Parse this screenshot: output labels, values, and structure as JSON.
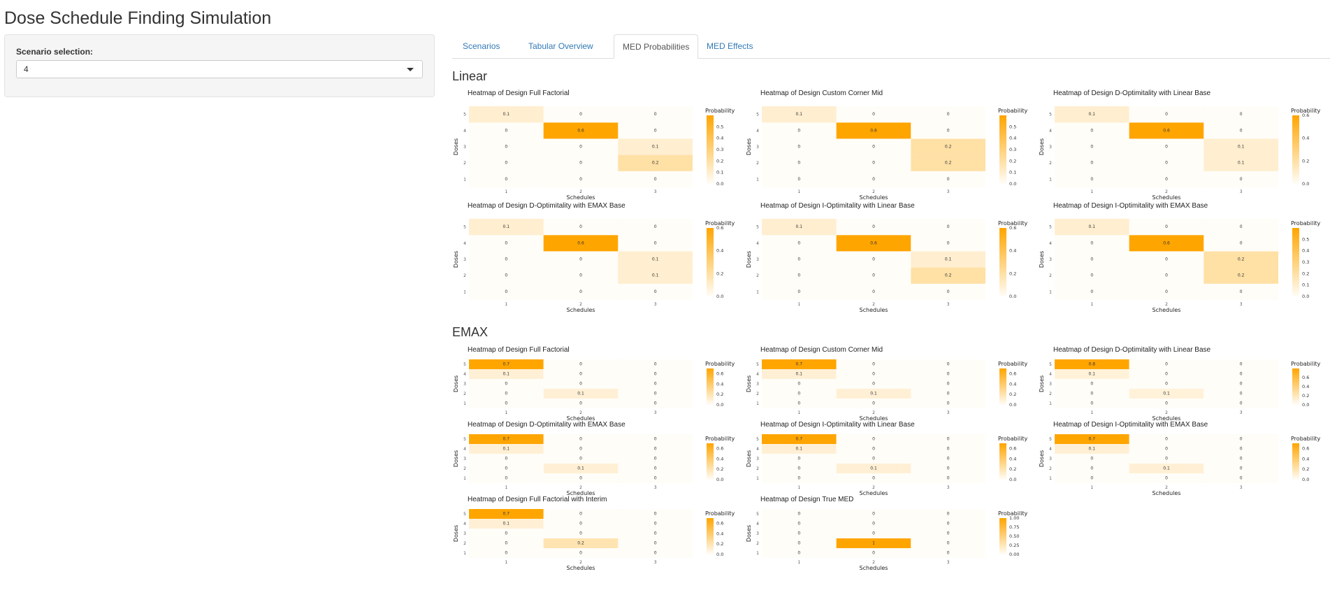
{
  "app": {
    "title": "Dose Schedule Finding Simulation"
  },
  "sidebar": {
    "scenario_label": "Scenario selection:",
    "scenario_value": "4"
  },
  "tabs": [
    {
      "label": "Scenarios",
      "active": false
    },
    {
      "label": "Tabular Overview",
      "active": false
    },
    {
      "label": "MED Probabilities",
      "active": true
    },
    {
      "label": "MED Effects",
      "active": false
    }
  ],
  "colors": {
    "low": "#fffdf8",
    "high": "#ffa500",
    "grid": "#eeeeee"
  },
  "axis": {
    "x_label": "Schedules",
    "y_label": "Doses",
    "x_ticks": [
      "1",
      "2",
      "3"
    ],
    "y_ticks": [
      "1",
      "2",
      "3",
      "4",
      "5"
    ],
    "legend_title": "Probability"
  },
  "sections": [
    {
      "name": "Linear",
      "chart_data": [
        {
          "type": "heatmap",
          "title": "Heatmap of Design Full Factorial",
          "values": [
            [
              0,
              0,
              0
            ],
            [
              0,
              0,
              0.2
            ],
            [
              0,
              0,
              0.1
            ],
            [
              0,
              0.6,
              0
            ],
            [
              0.1,
              0,
              0
            ]
          ],
          "legend_ticks": [
            "0.0",
            "0.1",
            "0.2",
            "0.3",
            "0.4",
            "0.5"
          ],
          "legend_max": 0.6
        },
        {
          "type": "heatmap",
          "title": "Heatmap of Design Custom Corner Mid",
          "values": [
            [
              0,
              0,
              0
            ],
            [
              0,
              0,
              0.2
            ],
            [
              0,
              0,
              0.2
            ],
            [
              0,
              0.6,
              0
            ],
            [
              0.1,
              0,
              0
            ]
          ],
          "legend_ticks": [
            "0.0",
            "0.1",
            "0.2",
            "0.3",
            "0.4",
            "0.5"
          ],
          "legend_max": 0.6
        },
        {
          "type": "heatmap",
          "title": "Heatmap of Design D-Optimitality with Linear Base",
          "values": [
            [
              0,
              0,
              0
            ],
            [
              0,
              0,
              0.1
            ],
            [
              0,
              0,
              0.1
            ],
            [
              0,
              0.6,
              0
            ],
            [
              0.1,
              0,
              0
            ]
          ],
          "legend_ticks": [
            "0.0",
            "0.2",
            "0.4",
            "0.6"
          ],
          "legend_max": 0.6
        },
        {
          "type": "heatmap",
          "title": "Heatmap of Design D-Optimitality with EMAX Base",
          "values": [
            [
              0,
              0,
              0
            ],
            [
              0,
              0,
              0.1
            ],
            [
              0,
              0,
              0.1
            ],
            [
              0,
              0.6,
              0
            ],
            [
              0.1,
              0,
              0
            ]
          ],
          "legend_ticks": [
            "0.0",
            "0.2",
            "0.4",
            "0.6"
          ],
          "legend_max": 0.6
        },
        {
          "type": "heatmap",
          "title": "Heatmap of Design I-Optimitality with Linear Base",
          "values": [
            [
              0,
              0,
              0
            ],
            [
              0,
              0,
              0.2
            ],
            [
              0,
              0,
              0.1
            ],
            [
              0,
              0.6,
              0
            ],
            [
              0.1,
              0,
              0
            ]
          ],
          "legend_ticks": [
            "0.0",
            "0.2",
            "0.4",
            "0.6"
          ],
          "legend_max": 0.6
        },
        {
          "type": "heatmap",
          "title": "Heatmap of Design I-Optimitality with EMAX Base",
          "values": [
            [
              0,
              0,
              0
            ],
            [
              0,
              0,
              0.2
            ],
            [
              0,
              0,
              0.2
            ],
            [
              0,
              0.6,
              0
            ],
            [
              0.1,
              0,
              0
            ]
          ],
          "legend_ticks": [
            "0.0",
            "0.1",
            "0.2",
            "0.3",
            "0.4",
            "0.5"
          ],
          "legend_max": 0.6
        }
      ]
    },
    {
      "name": "EMAX",
      "chart_data": [
        {
          "type": "heatmap",
          "title": "Heatmap of Design Full Factorial",
          "values": [
            [
              0,
              0,
              0
            ],
            [
              0,
              0.1,
              0
            ],
            [
              0,
              0,
              0
            ],
            [
              0.1,
              0,
              0
            ],
            [
              0.7,
              0,
              0
            ]
          ],
          "legend_ticks": [
            "0.0",
            "0.2",
            "0.4",
            "0.6"
          ],
          "legend_max": 0.7
        },
        {
          "type": "heatmap",
          "title": "Heatmap of Design Custom Corner Mid",
          "values": [
            [
              0,
              0,
              0
            ],
            [
              0,
              0.1,
              0
            ],
            [
              0,
              0,
              0
            ],
            [
              0.1,
              0,
              0
            ],
            [
              0.7,
              0,
              0
            ]
          ],
          "legend_ticks": [
            "0.0",
            "0.2",
            "0.4",
            "0.6"
          ],
          "legend_max": 0.7
        },
        {
          "type": "heatmap",
          "title": "Heatmap of Design D-Optimitality with Linear Base",
          "values": [
            [
              0,
              0,
              0
            ],
            [
              0,
              0.1,
              0
            ],
            [
              0,
              0,
              0
            ],
            [
              0.1,
              0,
              0
            ],
            [
              0.8,
              0,
              0
            ]
          ],
          "legend_ticks": [
            "0.0",
            "0.2",
            "0.4",
            "0.6"
          ],
          "legend_max": 0.8
        },
        {
          "type": "heatmap",
          "title": "Heatmap of Design D-Optimitality with EMAX Base",
          "values": [
            [
              0,
              0,
              0
            ],
            [
              0,
              0.1,
              0
            ],
            [
              0,
              0,
              0
            ],
            [
              0.1,
              0,
              0
            ],
            [
              0.7,
              0,
              0
            ]
          ],
          "legend_ticks": [
            "0.0",
            "0.2",
            "0.4",
            "0.6"
          ],
          "legend_max": 0.7
        },
        {
          "type": "heatmap",
          "title": "Heatmap of Design I-Optimitality with Linear Base",
          "values": [
            [
              0,
              0,
              0
            ],
            [
              0,
              0.1,
              0
            ],
            [
              0,
              0,
              0
            ],
            [
              0.1,
              0,
              0
            ],
            [
              0.7,
              0,
              0
            ]
          ],
          "legend_ticks": [
            "0.0",
            "0.2",
            "0.4",
            "0.6"
          ],
          "legend_max": 0.7
        },
        {
          "type": "heatmap",
          "title": "Heatmap of Design I-Optimitality with EMAX Base",
          "values": [
            [
              0,
              0,
              0
            ],
            [
              0,
              0.1,
              0
            ],
            [
              0,
              0,
              0
            ],
            [
              0.1,
              0,
              0
            ],
            [
              0.7,
              0,
              0
            ]
          ],
          "legend_ticks": [
            "0.0",
            "0.2",
            "0.4",
            "0.6"
          ],
          "legend_max": 0.7
        },
        {
          "type": "heatmap",
          "title": "Heatmap of Design Full Factorial with Interim",
          "values": [
            [
              0,
              0,
              0
            ],
            [
              0,
              0.2,
              0
            ],
            [
              0,
              0,
              0
            ],
            [
              0.1,
              0,
              0
            ],
            [
              0.7,
              0,
              0
            ]
          ],
          "legend_ticks": [
            "0.0",
            "0.2",
            "0.4",
            "0.6"
          ],
          "legend_max": 0.7
        },
        {
          "type": "heatmap",
          "title": "Heatmap of Design True MED",
          "values": [
            [
              0,
              0,
              0
            ],
            [
              0,
              1,
              0
            ],
            [
              0,
              0,
              0
            ],
            [
              0,
              0,
              0
            ],
            [
              0,
              0,
              0
            ]
          ],
          "legend_ticks": [
            "0.00",
            "0.25",
            "0.50",
            "0.75",
            "1.00"
          ],
          "legend_max": 1.0
        }
      ]
    }
  ]
}
